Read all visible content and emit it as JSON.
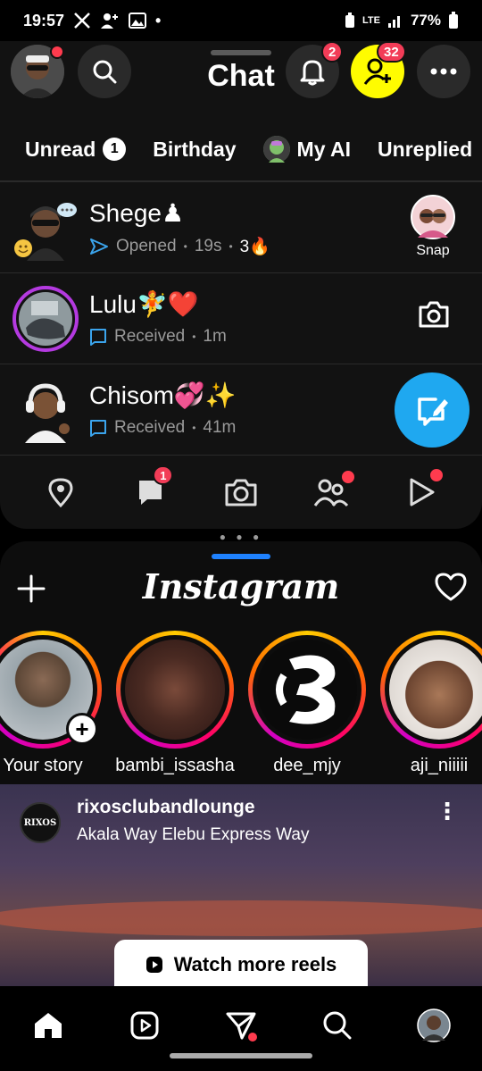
{
  "status_bar": {
    "time": "19:57",
    "network": "LTE",
    "battery": "77%"
  },
  "snapchat": {
    "title": "Chat",
    "notifications_badge": "2",
    "add_friends_badge": "32",
    "filters": [
      {
        "label": "Unread",
        "count": "1"
      },
      {
        "label": "Birthday"
      },
      {
        "label": "My AI"
      },
      {
        "label": "Unreplied"
      }
    ],
    "chats": [
      {
        "name": "Shege♟",
        "status": "Opened",
        "time": "19s",
        "streak": "3🔥",
        "action": "Snap"
      },
      {
        "name": "Lulu🧚❤️",
        "status": "Received",
        "time": "1m"
      },
      {
        "name": "Chisom💞✨",
        "status": "Received",
        "time": "41m"
      }
    ],
    "nav_chat_badge": "1"
  },
  "instagram": {
    "logo": "Instagram",
    "stories": [
      {
        "name": "Your story"
      },
      {
        "name": "bambi_issasha"
      },
      {
        "name": "dee_mjy"
      },
      {
        "name": "aji_niiiii"
      }
    ],
    "post": {
      "avatar_text": "RIXOS",
      "username": "rixosclubandlounge",
      "location": "Akala Way Elebu Express Way"
    },
    "watch_more": "Watch more reels"
  },
  "colors": {
    "snap_yellow": "#FFFC00",
    "badge_red": "#F23C57",
    "fab_blue": "#1FA8F0",
    "ig_blue": "#1F82FF"
  }
}
